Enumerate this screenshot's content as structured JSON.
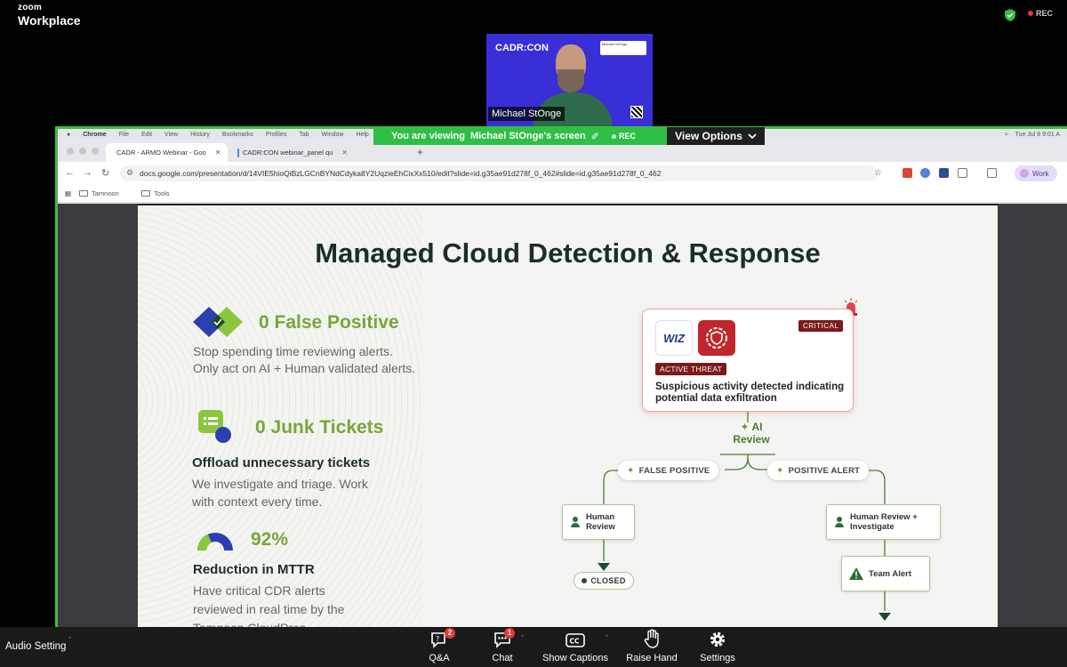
{
  "zoom": {
    "logo_line1": "zoom",
    "logo_line2": "Workplace",
    "rec_label": "REC",
    "speaker_name": "Michael StOnge",
    "speaker_brand": "CADR:CON",
    "speaker_tag_name": "Michael StOnge",
    "viewing_prefix": "You are viewing",
    "viewing_name": "Michael StOnge's screen",
    "viewing_rec": "REC",
    "view_options": "View Options",
    "audio_setting": "Audio Setting",
    "toolbar": [
      {
        "label": "Q&A",
        "badge": "2"
      },
      {
        "label": "Chat",
        "badge": "1"
      },
      {
        "label": "Show Captions",
        "badge": ""
      },
      {
        "label": "Raise Hand",
        "badge": ""
      },
      {
        "label": "Settings",
        "badge": ""
      }
    ]
  },
  "mac": {
    "menu": [
      "Chrome",
      "File",
      "Edit",
      "View",
      "History",
      "Bookmarks",
      "Profiles",
      "Tab",
      "Window",
      "Help"
    ],
    "clock": "Tue Jul 8  9:01 A"
  },
  "browser": {
    "tabs": [
      {
        "title": "CADR - ARMO Webinar - Goo",
        "active": true,
        "favicon_color": "#f4b400"
      },
      {
        "title": "CADR:CON webinar_panel qu",
        "active": false,
        "favicon_color": "#4285f4"
      }
    ],
    "url": "docs.google.com/presentation/d/14VIE5hioQiBzLGCnBYNdCdyka8Y2UqzieEhCixXx510/edit?slide=id.g35ae91d278f_0_462#slide=id.g35ae91d278f_0_462",
    "profile": "Work",
    "bookmarks": [
      "Tamnoon",
      "Tools"
    ]
  },
  "slide": {
    "title": "Managed Cloud Detection & Response",
    "features": [
      {
        "title": "0 False Positive",
        "subtitle": "",
        "text_lines": [
          "Stop spending time reviewing alerts.",
          "Only act on AI + Human validated alerts."
        ]
      },
      {
        "title": "0 Junk Tickets",
        "subtitle": "Offload unnecessary tickets",
        "text_lines": [
          "We investigate and triage. Work",
          "with context every time."
        ]
      },
      {
        "title": "92%",
        "subtitle": "Reduction in MTTR",
        "text_lines": [
          "Have critical CDR alerts",
          "reviewed in real time by the",
          "Tamnoon CloudPros"
        ]
      }
    ],
    "diagram": {
      "wiz_label": "WIZ",
      "critical": "CRITICAL",
      "active_threat": "ACTIVE THREAT",
      "alert_text": "Suspicious activity detected indicating potential data exfiltration",
      "ai_review_line1": "AI",
      "ai_review_line2": "Review",
      "false_positive": "FALSE POSITIVE",
      "positive_alert": "POSITIVE ALERT",
      "human_review_line1": "Human",
      "human_review_line2": "Review",
      "human_investigate_line1": "Human Review +",
      "human_investigate_line2": "Investigate",
      "team_alert": "Team Alert",
      "closed": "CLOSED"
    }
  }
}
